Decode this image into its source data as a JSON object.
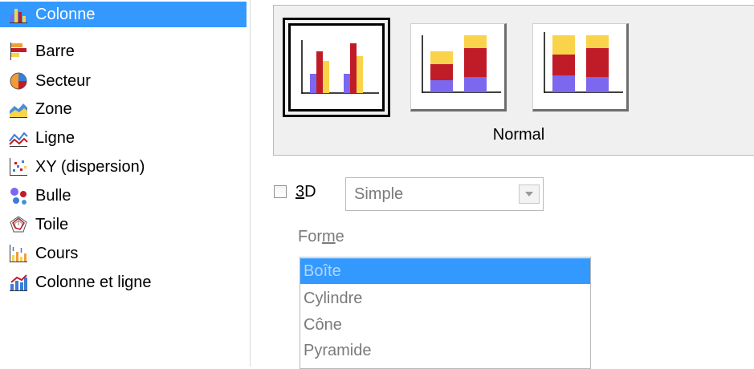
{
  "chart_types": {
    "items": [
      {
        "label": "Colonne",
        "icon": "column-chart-icon",
        "selected": true
      },
      {
        "label": "Barre",
        "icon": "bar-chart-icon",
        "selected": false
      },
      {
        "label": "Secteur",
        "icon": "pie-chart-icon",
        "selected": false
      },
      {
        "label": "Zone",
        "icon": "area-chart-icon",
        "selected": false
      },
      {
        "label": "Ligne",
        "icon": "line-chart-icon",
        "selected": false
      },
      {
        "label": "XY (dispersion)",
        "icon": "scatter-chart-icon",
        "selected": false
      },
      {
        "label": "Bulle",
        "icon": "bubble-chart-icon",
        "selected": false
      },
      {
        "label": "Toile",
        "icon": "net-chart-icon",
        "selected": false
      },
      {
        "label": "Cours",
        "icon": "stock-chart-icon",
        "selected": false
      },
      {
        "label": "Colonne et ligne",
        "icon": "column-line-chart-icon",
        "selected": false
      }
    ]
  },
  "variants": {
    "items": [
      {
        "icon": "column-normal-icon",
        "selected": true
      },
      {
        "icon": "column-stacked-icon",
        "selected": false
      },
      {
        "icon": "column-percent-stacked-icon",
        "selected": false
      }
    ],
    "name": "Normal"
  },
  "three_d": {
    "checkbox_checked": false,
    "label_accel": "3",
    "label_rest": "D",
    "select_value": "Simple"
  },
  "shape": {
    "label_pre": "For",
    "label_accel": "m",
    "label_post": "e",
    "items": [
      {
        "label": "Boîte",
        "selected": true
      },
      {
        "label": "Cylindre",
        "selected": false
      },
      {
        "label": "Cône",
        "selected": false
      },
      {
        "label": "Pyramide",
        "selected": false
      }
    ]
  },
  "colors": {
    "selection": "#3399ff",
    "bar_purple": "#7b68ee",
    "bar_red": "#c01c28",
    "bar_yellow": "#f9d34a"
  }
}
